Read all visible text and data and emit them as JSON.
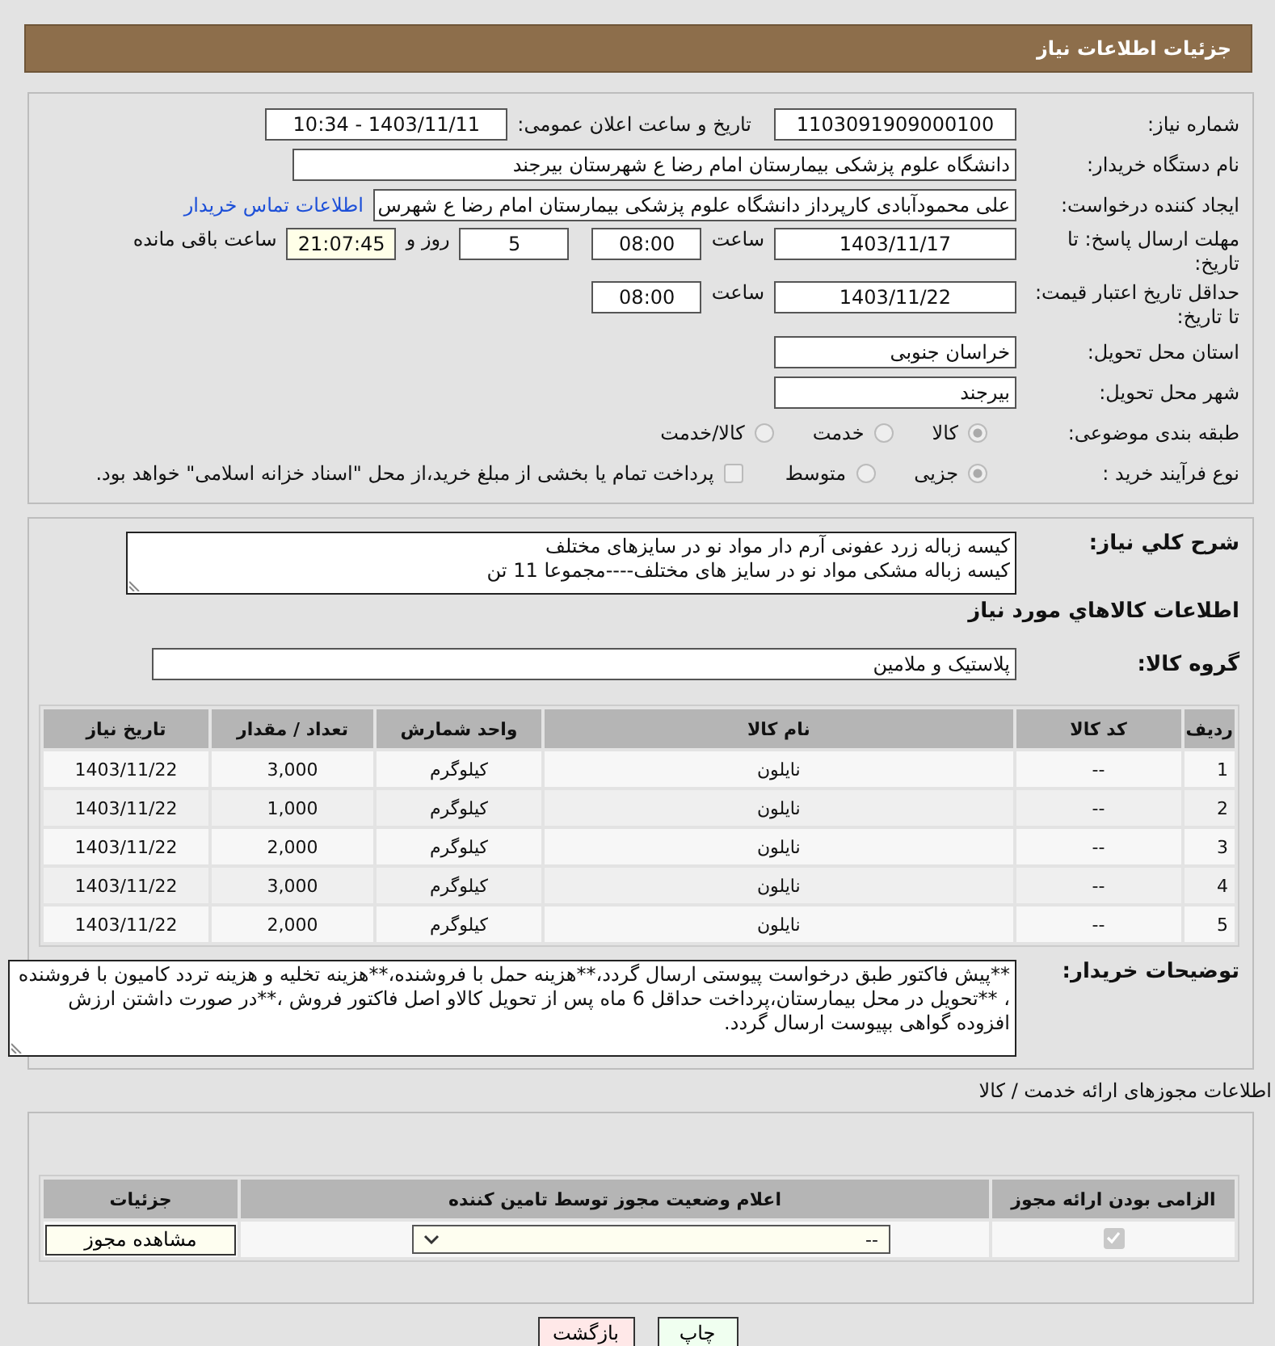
{
  "header": {
    "title": "جزئیات اطلاعات نیاز"
  },
  "need_number": {
    "label": "شماره نیاز:",
    "value": "1103091909000100"
  },
  "announce_datetime": {
    "label": "تاریخ و ساعت اعلان عمومی:",
    "value": "1403/11/11 - 10:34"
  },
  "buyer_org": {
    "label": "نام دستگاه خریدار:",
    "value": "دانشگاه علوم پزشکی  بیمارستان امام رضا ع  شهرستان بیرجند"
  },
  "requester": {
    "label": "ایجاد کننده درخواست:",
    "value": "علی محمودآبادی کارپرداز دانشگاه علوم پزشکی  بیمارستان امام رضا ع  شهرس",
    "link": "اطلاعات تماس خریدار"
  },
  "reply_deadline": {
    "label": "مهلت ارسال پاسخ: تا تاریخ:",
    "date": "1403/11/17",
    "time_label": "ساعت",
    "time": "08:00",
    "days": "5",
    "days_label": "روز و",
    "remaining": "21:07:45",
    "remaining_label": "ساعت باقی مانده"
  },
  "price_validity": {
    "label": "حداقل تاریخ اعتبار قیمت: تا تاریخ:",
    "date": "1403/11/22",
    "time_label": "ساعت",
    "time": "08:00"
  },
  "province": {
    "label": "استان محل تحویل:",
    "value": "خراسان جنوبی"
  },
  "city": {
    "label": "شهر محل تحویل:",
    "value": "بیرجند"
  },
  "category": {
    "label": "طبقه بندی موضوعی:",
    "options": [
      {
        "label": "کالا",
        "selected": true
      },
      {
        "label": "خدمت",
        "selected": false
      },
      {
        "label": "کالا/خدمت",
        "selected": false
      }
    ]
  },
  "purchase_process": {
    "label": "نوع فرآیند خرید :",
    "options": [
      {
        "label": "جزیی",
        "selected": true
      },
      {
        "label": "متوسط",
        "selected": false
      }
    ],
    "treasury": {
      "label": "پرداخت تمام یا بخشی از مبلغ خرید،از محل \"اسناد خزانه اسلامی\" خواهد بود.",
      "checked": false
    }
  },
  "description": {
    "label": "شرح کلي نياز:",
    "lines": [
      "کیسه زباله زرد عفونی آرم دار مواد نو در سایزهای مختلف",
      "کیسه زباله مشکی مواد نو در سایز های مختلف----مجموعا 11 تن"
    ]
  },
  "goods_heading": "اطلاعات كالاهاي مورد نياز",
  "goods_group": {
    "label": "گروه کالا:",
    "value": "پلاستیک و ملامین"
  },
  "goods_table": {
    "columns": [
      "ردیف",
      "کد کالا",
      "نام کالا",
      "واحد شمارش",
      "تعداد / مقدار",
      "تاریخ نیاز"
    ],
    "rows": [
      [
        "1",
        "--",
        "نایلون",
        "کیلوگرم",
        "3,000",
        "1403/11/22"
      ],
      [
        "2",
        "--",
        "نایلون",
        "کیلوگرم",
        "1,000",
        "1403/11/22"
      ],
      [
        "3",
        "--",
        "نایلون",
        "کیلوگرم",
        "2,000",
        "1403/11/22"
      ],
      [
        "4",
        "--",
        "نایلون",
        "کیلوگرم",
        "3,000",
        "1403/11/22"
      ],
      [
        "5",
        "--",
        "نایلون",
        "کیلوگرم",
        "2,000",
        "1403/11/22"
      ]
    ]
  },
  "buyer_notes": {
    "label": "توضیحات خریدار:",
    "value": "**پیش فاکتور طبق درخواست پیوستی ارسال گردد،**هزینه حمل با فروشنده،**هزینه تخلیه و هزینه تردد کامیون با فروشنده ، **تحویل در محل بیمارستان،پرداخت حداقل 6 ماه پس از تحویل کالاو اصل فاکتور فروش ،**در صورت داشتن ارزش افزوده گواهی بپیوست ارسال گردد."
  },
  "licenses_heading": "اطلاعات مجوزهای ارائه خدمت / کالا",
  "licenses_table": {
    "columns": [
      "الزامی بودن ارائه مجوز",
      "اعلام وضعیت مجوز توسط تامین کننده",
      "جزئیات"
    ],
    "rows": [
      {
        "required": true,
        "status": "--",
        "details_button": "مشاهده مجوز"
      }
    ]
  },
  "buttons": [
    {
      "label": "چاپ",
      "kind": "print"
    },
    {
      "label": "بازگشت",
      "kind": "back"
    }
  ]
}
